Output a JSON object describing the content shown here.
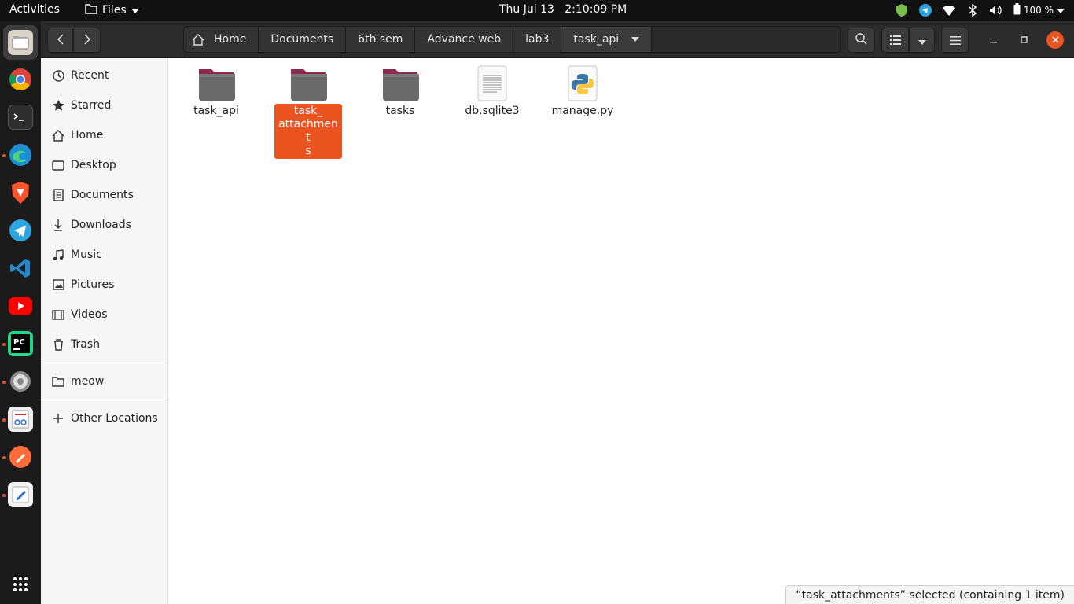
{
  "topbar": {
    "activities": "Activities",
    "app_name": "Files",
    "date": "Thu Jul 13",
    "time": "2:10:09 PM",
    "battery": "100 %"
  },
  "dock": {
    "items": [
      "files-icon",
      "chrome-icon",
      "terminal-icon",
      "edge-icon",
      "brave-icon",
      "telegram-icon",
      "vscode-icon",
      "youtube-icon",
      "pycharm-icon",
      "settings-icon",
      "document-viewer-icon",
      "postman-icon",
      "text-editor-icon",
      "app-grid-icon"
    ]
  },
  "pathbar": {
    "crumbs": [
      "Home",
      "Documents",
      "6th sem",
      "Advance web",
      "lab3",
      "task_api"
    ]
  },
  "sidebar": {
    "items": [
      {
        "label": "Recent",
        "icon": "clock-icon"
      },
      {
        "label": "Starred",
        "icon": "star-icon"
      },
      {
        "label": "Home",
        "icon": "home-icon"
      },
      {
        "label": "Desktop",
        "icon": "desktop-icon"
      },
      {
        "label": "Documents",
        "icon": "documents-icon"
      },
      {
        "label": "Downloads",
        "icon": "download-icon"
      },
      {
        "label": "Music",
        "icon": "music-icon"
      },
      {
        "label": "Pictures",
        "icon": "pictures-icon"
      },
      {
        "label": "Videos",
        "icon": "videos-icon"
      },
      {
        "label": "Trash",
        "icon": "trash-icon"
      }
    ],
    "bookmarks": [
      {
        "label": "meow",
        "icon": "folder-icon"
      }
    ],
    "other": {
      "label": "Other Locations",
      "icon": "plus-icon"
    }
  },
  "files": [
    {
      "name": "task_api",
      "type": "folder",
      "selected": false
    },
    {
      "name": "task_\nattachment\ns",
      "type": "folder",
      "selected": true
    },
    {
      "name": "tasks",
      "type": "folder",
      "selected": false
    },
    {
      "name": "db.sqlite3",
      "type": "text-file",
      "selected": false
    },
    {
      "name": "manage.py",
      "type": "python-file",
      "selected": false
    }
  ],
  "status": "“task_attachments” selected  (containing 1 item)",
  "colors": {
    "accent": "#e95420",
    "folder_top": "#8a2a4c",
    "folder_body": "#6a6a6a"
  }
}
